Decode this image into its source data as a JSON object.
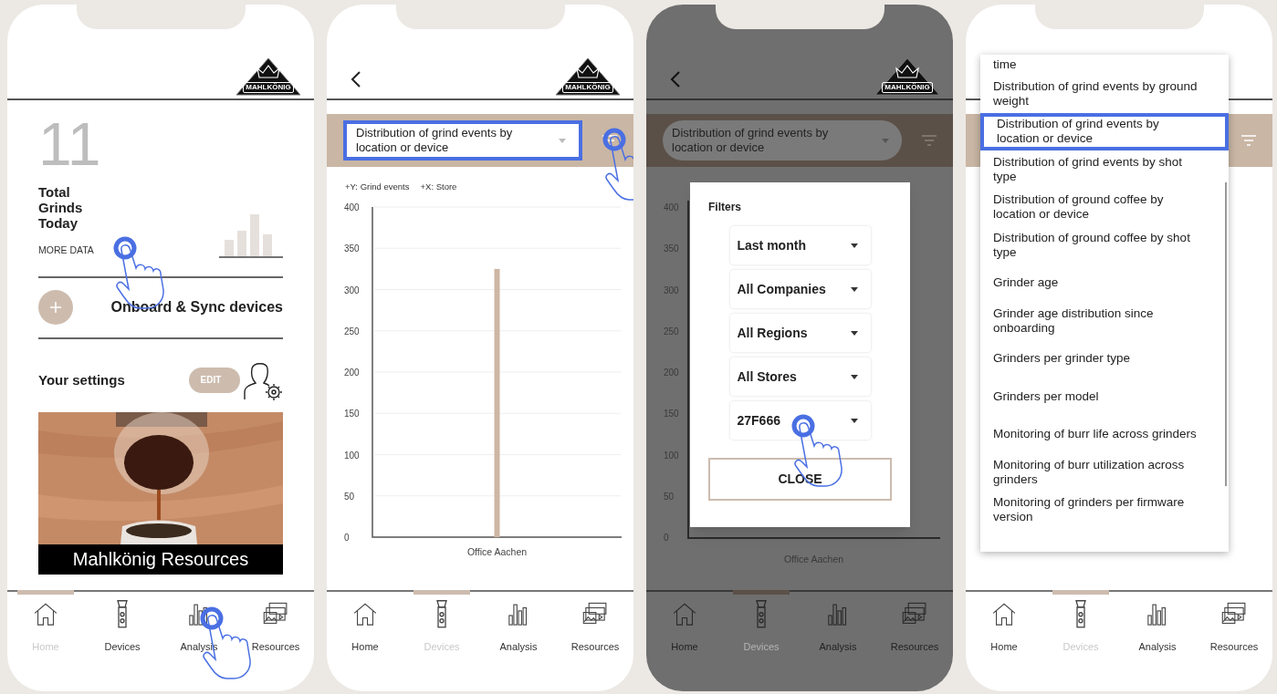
{
  "phones": [
    {
      "kind": "home",
      "dimmed": false,
      "logo": "MAHLKÖNIG",
      "stat": {
        "value": "11",
        "label": "Total Grinds Today",
        "link": "MORE DATA"
      },
      "onboard": {
        "label": "Onboard & Sync devices"
      },
      "settings": {
        "label": "Your settings",
        "button": "EDIT"
      },
      "resources_card": {
        "kind": "picture",
        "caption": "Mahlkönig Resources"
      },
      "nav": [
        {
          "label": "Home",
          "selected": true
        },
        {
          "label": "Devices",
          "selected": false
        },
        {
          "label": "Analysis",
          "selected": false
        },
        {
          "label": "Resources",
          "selected": false
        }
      ]
    },
    {
      "kind": "analysis",
      "dimmed": false,
      "logo": "MAHLKÖNIG",
      "report_select": {
        "value": "Distribution of grind events by location or device",
        "highlighted": true
      },
      "chart_data": {
        "type": "bar",
        "ylabel": "+Y: Grind events",
        "xlabel": "+X: Store",
        "categories": [
          "Office Aachen"
        ],
        "values": [
          325
        ],
        "ylim": [
          0,
          400
        ],
        "yticks": [
          0,
          50,
          100,
          150,
          200,
          250,
          300,
          350,
          400
        ],
        "grid": true
      },
      "nav": [
        {
          "label": "Home",
          "selected": false
        },
        {
          "label": "Devices",
          "selected": true
        },
        {
          "label": "Analysis",
          "selected": false
        },
        {
          "label": "Resources",
          "selected": false
        }
      ]
    },
    {
      "kind": "analysis",
      "dimmed": true,
      "logo": "MAHLKÖNIG",
      "report_select": {
        "value": "Distribution of grind events by location or device",
        "highlighted": false
      },
      "backdrop_chart": {
        "ticks": [
          "400",
          "350",
          "300",
          "250",
          "200",
          "150",
          "100",
          "50",
          "0"
        ],
        "category": "Office Aachen"
      },
      "filters_dialog": {
        "title": "Filters",
        "selects": [
          "Last month",
          "All Companies",
          "All Regions",
          "All Stores",
          "27F666"
        ],
        "button": "CLOSE"
      },
      "nav": [
        {
          "label": "Home",
          "selected": false
        },
        {
          "label": "Devices",
          "selected": true
        },
        {
          "label": "Analysis",
          "selected": false
        },
        {
          "label": "Resources",
          "selected": false
        }
      ]
    },
    {
      "kind": "report_list",
      "dimmed": false,
      "report_list": [
        {
          "label": "time",
          "selected": false
        },
        {
          "label": "Distribution of grind events by ground weight",
          "selected": false
        },
        {
          "label": "Distribution of grind events by location or device",
          "selected": true
        },
        {
          "label": "Distribution of grind events by shot type",
          "selected": false
        },
        {
          "label": "Distribution of ground coffee by location or device",
          "selected": false
        },
        {
          "label": "Distribution of ground coffee by shot type",
          "selected": false
        },
        {
          "label": "Grinder age",
          "selected": false
        },
        {
          "label": "Grinder age distribution since onboarding",
          "selected": false
        },
        {
          "label": "Grinders per grinder type",
          "selected": false
        },
        {
          "label": "Grinders per model",
          "selected": false
        },
        {
          "label": "Monitoring of burr life across grinders",
          "selected": false
        },
        {
          "label": "Monitoring of burr utilization across grinders",
          "selected": false
        },
        {
          "label": "Monitoring of grinders per firmware version",
          "selected": false
        }
      ],
      "nav": [
        {
          "label": "Home",
          "selected": false
        },
        {
          "label": "Devices",
          "selected": true
        },
        {
          "label": "Analysis",
          "selected": false
        },
        {
          "label": "Resources",
          "selected": false
        }
      ]
    }
  ]
}
